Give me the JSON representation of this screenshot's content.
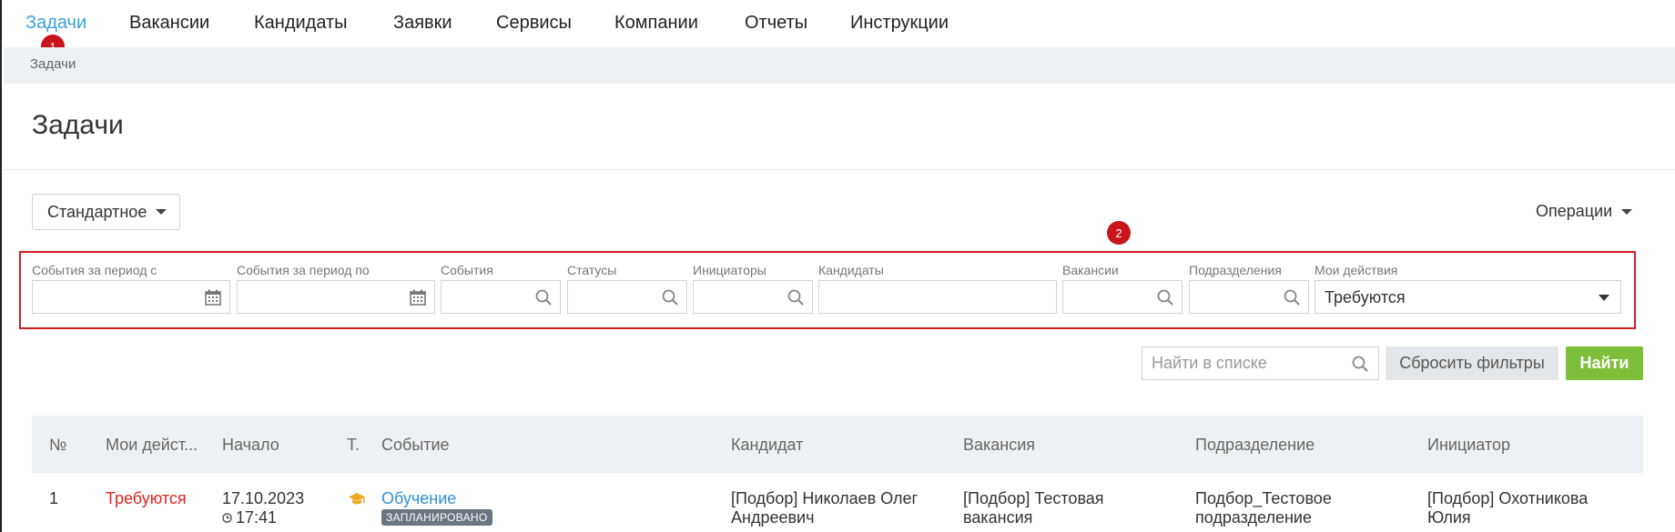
{
  "nav": {
    "items": [
      {
        "label": "Задачи",
        "active": true
      },
      {
        "label": "Вакансии"
      },
      {
        "label": "Кандидаты"
      },
      {
        "label": "Заявки"
      },
      {
        "label": "Сервисы"
      },
      {
        "label": "Компании"
      },
      {
        "label": "Отчеты"
      },
      {
        "label": "Инструкции"
      }
    ]
  },
  "markers": {
    "m1": "1",
    "m2": "2"
  },
  "breadcrumb": "Задачи",
  "page_title": "Задачи",
  "toolbar": {
    "view_label": "Стандартное",
    "operations_label": "Операции"
  },
  "filters": {
    "period_from": {
      "label": "События за период с",
      "icon": "calendar-icon"
    },
    "period_to": {
      "label": "События за период по",
      "icon": "calendar-icon"
    },
    "events": {
      "label": "События",
      "icon": "search-icon"
    },
    "statuses": {
      "label": "Статусы",
      "icon": "search-icon"
    },
    "initiators": {
      "label": "Инициаторы",
      "icon": "search-icon"
    },
    "candidates": {
      "label": "Кандидаты"
    },
    "vacancies": {
      "label": "Вакансии",
      "icon": "search-icon"
    },
    "departments": {
      "label": "Подразделения",
      "icon": "search-icon"
    },
    "my_actions": {
      "label": "Мои действия",
      "value": "Требуются"
    }
  },
  "search": {
    "placeholder": "Найти в списке",
    "reset_label": "Сбросить фильтры",
    "find_label": "Найти"
  },
  "table": {
    "columns": [
      "№",
      "Мои дейст...",
      "Начало",
      "Т.",
      "Событие",
      "Кандидат",
      "Вакансия",
      "Подразделение",
      "Инициатор"
    ],
    "rows": [
      {
        "num": "1",
        "my_action": "Требуются",
        "start_date": "17.10.2023",
        "start_time": "17:41",
        "type_icon": "graduation-cap-icon",
        "event": "Обучение",
        "event_status": "ЗАПЛАНИРОВАНО",
        "candidate_1": "[Подбор] Николаев Олег",
        "candidate_2": "Андреевич",
        "vacancy_1": "[Подбор] Тестовая",
        "vacancy_2": "вакансия",
        "department_1": "Подбор_Тестовое",
        "department_2": "подразделение",
        "initiator_1": "[Подбор] Охотникова",
        "initiator_2": "Юлия"
      }
    ]
  },
  "colors": {
    "accent": "#3aa0de",
    "marker": "#c8141b",
    "find_button": "#7dbf3b",
    "alert_text": "#e0241f"
  }
}
